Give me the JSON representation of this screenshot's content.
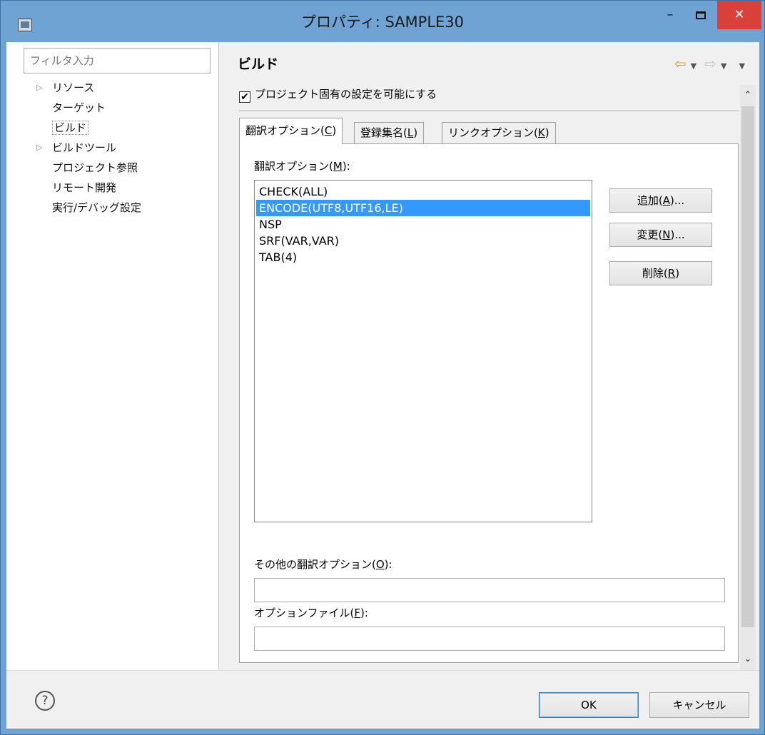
{
  "window": {
    "title": "プロパティ: SAMPLE30",
    "minimize": "–",
    "close": "✕"
  },
  "filter": {
    "placeholder": "フィルタ入力"
  },
  "tree": [
    {
      "label": "リソース",
      "expandable": true
    },
    {
      "label": "ターゲット",
      "expandable": false
    },
    {
      "label": "ビルド",
      "expandable": false,
      "selected": true
    },
    {
      "label": "ビルドツール",
      "expandable": true
    },
    {
      "label": "プロジェクト参照",
      "expandable": false
    },
    {
      "label": "リモート開発",
      "expandable": false
    },
    {
      "label": "実行/デバッグ設定",
      "expandable": false
    }
  ],
  "page": {
    "title": "ビルド",
    "enable_label": "プロジェクト固有の設定を可能にする",
    "enable_checked": true
  },
  "tabs": [
    {
      "label": "翻訳オプション(",
      "key": "C",
      "end": ")",
      "active": true
    },
    {
      "label": "登録集名(",
      "key": "L",
      "end": ")",
      "active": false
    },
    {
      "label": "リンクオプション(",
      "key": "K",
      "end": ")",
      "active": false
    }
  ],
  "options": {
    "label": "翻訳オプション(",
    "key": "M",
    "end": "):",
    "items": [
      "CHECK(ALL)",
      "ENCODE(UTF8,UTF16,LE)",
      "NSP",
      "SRF(VAR,VAR)",
      "TAB(4)"
    ],
    "selected_index": 1
  },
  "buttons": {
    "add": {
      "label": "追加(",
      "key": "A",
      "end": ")..."
    },
    "change": {
      "label": "変更(",
      "key": "N",
      "end": ")..."
    },
    "delete": {
      "label": "削除(",
      "key": "R",
      "end": ")"
    }
  },
  "other_options": {
    "label": "その他の翻訳オプション(",
    "key": "O",
    "end": "):",
    "value": ""
  },
  "option_file": {
    "label": "オプションファイル(",
    "key": "F",
    "end": "):",
    "value": ""
  },
  "dialog": {
    "help": "?",
    "ok": "OK",
    "cancel": "キャンセル"
  },
  "colors": {
    "titlebar": "#6fa3d4",
    "close": "#d9403a",
    "selection": "#3399ff"
  },
  "icons": [
    "app-icon",
    "back-arrow-icon",
    "forward-arrow-icon",
    "help-icon",
    "scroll-up-icon",
    "scroll-down-icon"
  ]
}
